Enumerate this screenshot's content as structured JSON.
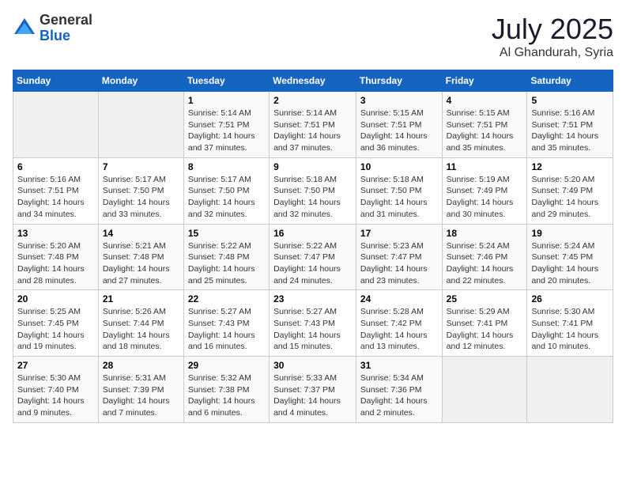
{
  "header": {
    "logo_general": "General",
    "logo_blue": "Blue",
    "month_year": "July 2025",
    "location": "Al Ghandurah, Syria"
  },
  "days_of_week": [
    "Sunday",
    "Monday",
    "Tuesday",
    "Wednesday",
    "Thursday",
    "Friday",
    "Saturday"
  ],
  "weeks": [
    [
      {
        "day": "",
        "info": ""
      },
      {
        "day": "",
        "info": ""
      },
      {
        "day": "1",
        "sunrise": "Sunrise: 5:14 AM",
        "sunset": "Sunset: 7:51 PM",
        "daylight": "Daylight: 14 hours and 37 minutes."
      },
      {
        "day": "2",
        "sunrise": "Sunrise: 5:14 AM",
        "sunset": "Sunset: 7:51 PM",
        "daylight": "Daylight: 14 hours and 37 minutes."
      },
      {
        "day": "3",
        "sunrise": "Sunrise: 5:15 AM",
        "sunset": "Sunset: 7:51 PM",
        "daylight": "Daylight: 14 hours and 36 minutes."
      },
      {
        "day": "4",
        "sunrise": "Sunrise: 5:15 AM",
        "sunset": "Sunset: 7:51 PM",
        "daylight": "Daylight: 14 hours and 35 minutes."
      },
      {
        "day": "5",
        "sunrise": "Sunrise: 5:16 AM",
        "sunset": "Sunset: 7:51 PM",
        "daylight": "Daylight: 14 hours and 35 minutes."
      }
    ],
    [
      {
        "day": "6",
        "sunrise": "Sunrise: 5:16 AM",
        "sunset": "Sunset: 7:51 PM",
        "daylight": "Daylight: 14 hours and 34 minutes."
      },
      {
        "day": "7",
        "sunrise": "Sunrise: 5:17 AM",
        "sunset": "Sunset: 7:50 PM",
        "daylight": "Daylight: 14 hours and 33 minutes."
      },
      {
        "day": "8",
        "sunrise": "Sunrise: 5:17 AM",
        "sunset": "Sunset: 7:50 PM",
        "daylight": "Daylight: 14 hours and 32 minutes."
      },
      {
        "day": "9",
        "sunrise": "Sunrise: 5:18 AM",
        "sunset": "Sunset: 7:50 PM",
        "daylight": "Daylight: 14 hours and 32 minutes."
      },
      {
        "day": "10",
        "sunrise": "Sunrise: 5:18 AM",
        "sunset": "Sunset: 7:50 PM",
        "daylight": "Daylight: 14 hours and 31 minutes."
      },
      {
        "day": "11",
        "sunrise": "Sunrise: 5:19 AM",
        "sunset": "Sunset: 7:49 PM",
        "daylight": "Daylight: 14 hours and 30 minutes."
      },
      {
        "day": "12",
        "sunrise": "Sunrise: 5:20 AM",
        "sunset": "Sunset: 7:49 PM",
        "daylight": "Daylight: 14 hours and 29 minutes."
      }
    ],
    [
      {
        "day": "13",
        "sunrise": "Sunrise: 5:20 AM",
        "sunset": "Sunset: 7:48 PM",
        "daylight": "Daylight: 14 hours and 28 minutes."
      },
      {
        "day": "14",
        "sunrise": "Sunrise: 5:21 AM",
        "sunset": "Sunset: 7:48 PM",
        "daylight": "Daylight: 14 hours and 27 minutes."
      },
      {
        "day": "15",
        "sunrise": "Sunrise: 5:22 AM",
        "sunset": "Sunset: 7:48 PM",
        "daylight": "Daylight: 14 hours and 25 minutes."
      },
      {
        "day": "16",
        "sunrise": "Sunrise: 5:22 AM",
        "sunset": "Sunset: 7:47 PM",
        "daylight": "Daylight: 14 hours and 24 minutes."
      },
      {
        "day": "17",
        "sunrise": "Sunrise: 5:23 AM",
        "sunset": "Sunset: 7:47 PM",
        "daylight": "Daylight: 14 hours and 23 minutes."
      },
      {
        "day": "18",
        "sunrise": "Sunrise: 5:24 AM",
        "sunset": "Sunset: 7:46 PM",
        "daylight": "Daylight: 14 hours and 22 minutes."
      },
      {
        "day": "19",
        "sunrise": "Sunrise: 5:24 AM",
        "sunset": "Sunset: 7:45 PM",
        "daylight": "Daylight: 14 hours and 20 minutes."
      }
    ],
    [
      {
        "day": "20",
        "sunrise": "Sunrise: 5:25 AM",
        "sunset": "Sunset: 7:45 PM",
        "daylight": "Daylight: 14 hours and 19 minutes."
      },
      {
        "day": "21",
        "sunrise": "Sunrise: 5:26 AM",
        "sunset": "Sunset: 7:44 PM",
        "daylight": "Daylight: 14 hours and 18 minutes."
      },
      {
        "day": "22",
        "sunrise": "Sunrise: 5:27 AM",
        "sunset": "Sunset: 7:43 PM",
        "daylight": "Daylight: 14 hours and 16 minutes."
      },
      {
        "day": "23",
        "sunrise": "Sunrise: 5:27 AM",
        "sunset": "Sunset: 7:43 PM",
        "daylight": "Daylight: 14 hours and 15 minutes."
      },
      {
        "day": "24",
        "sunrise": "Sunrise: 5:28 AM",
        "sunset": "Sunset: 7:42 PM",
        "daylight": "Daylight: 14 hours and 13 minutes."
      },
      {
        "day": "25",
        "sunrise": "Sunrise: 5:29 AM",
        "sunset": "Sunset: 7:41 PM",
        "daylight": "Daylight: 14 hours and 12 minutes."
      },
      {
        "day": "26",
        "sunrise": "Sunrise: 5:30 AM",
        "sunset": "Sunset: 7:41 PM",
        "daylight": "Daylight: 14 hours and 10 minutes."
      }
    ],
    [
      {
        "day": "27",
        "sunrise": "Sunrise: 5:30 AM",
        "sunset": "Sunset: 7:40 PM",
        "daylight": "Daylight: 14 hours and 9 minutes."
      },
      {
        "day": "28",
        "sunrise": "Sunrise: 5:31 AM",
        "sunset": "Sunset: 7:39 PM",
        "daylight": "Daylight: 14 hours and 7 minutes."
      },
      {
        "day": "29",
        "sunrise": "Sunrise: 5:32 AM",
        "sunset": "Sunset: 7:38 PM",
        "daylight": "Daylight: 14 hours and 6 minutes."
      },
      {
        "day": "30",
        "sunrise": "Sunrise: 5:33 AM",
        "sunset": "Sunset: 7:37 PM",
        "daylight": "Daylight: 14 hours and 4 minutes."
      },
      {
        "day": "31",
        "sunrise": "Sunrise: 5:34 AM",
        "sunset": "Sunset: 7:36 PM",
        "daylight": "Daylight: 14 hours and 2 minutes."
      },
      {
        "day": "",
        "info": ""
      },
      {
        "day": "",
        "info": ""
      }
    ]
  ]
}
